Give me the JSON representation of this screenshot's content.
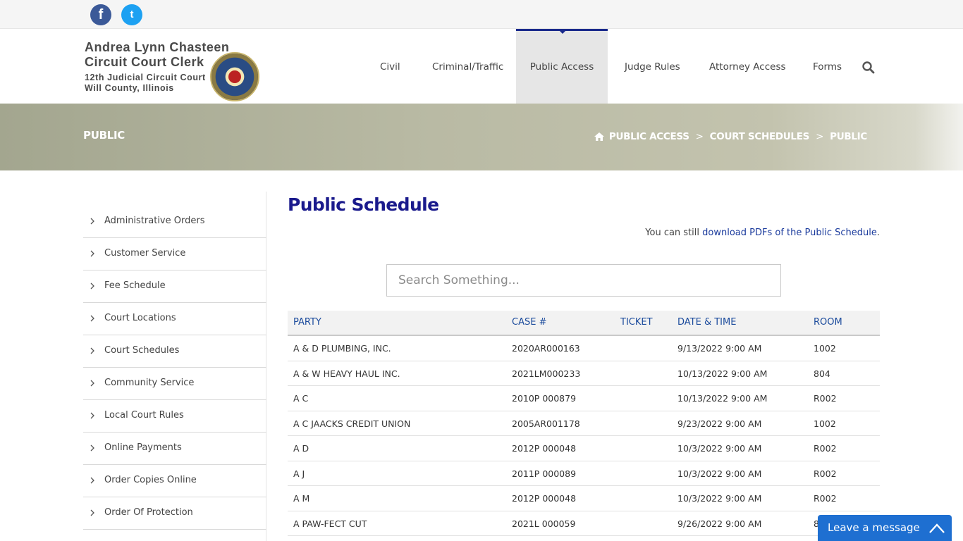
{
  "social": {
    "facebook_glyph": "f",
    "twitter_glyph": "t"
  },
  "logo": {
    "line1": "Andrea Lynn Chasteen",
    "line2": "Circuit Court Clerk",
    "line3": "12th Judicial Circuit Court",
    "line4": "Will County, Illinois"
  },
  "nav": [
    {
      "label": "Civil"
    },
    {
      "label": "Criminal/Traffic"
    },
    {
      "label": "Public Access",
      "active": true
    },
    {
      "label": "Judge Rules"
    },
    {
      "label": "Attorney Access"
    },
    {
      "label": "Forms"
    }
  ],
  "banner": {
    "title": "PUBLIC",
    "crumbs": [
      "PUBLIC ACCESS",
      "COURT SCHEDULES",
      "PUBLIC"
    ],
    "separator": ">"
  },
  "sidebar": {
    "items": [
      {
        "label": "Administrative Orders"
      },
      {
        "label": "Customer Service"
      },
      {
        "label": "Fee Schedule"
      },
      {
        "label": "Court Locations"
      },
      {
        "label": "Court Schedules"
      },
      {
        "label": "Community Service"
      },
      {
        "label": "Local Court Rules"
      },
      {
        "label": "Online Payments"
      },
      {
        "label": "Order Copies Online"
      },
      {
        "label": "Order Of Protection"
      }
    ]
  },
  "main": {
    "title": "Public Schedule",
    "note_prefix": "You can still ",
    "note_link": "download PDFs of the Public Schedule",
    "note_suffix": ".",
    "search_placeholder": "Search Something..."
  },
  "table": {
    "headers": [
      "PARTY",
      "CASE #",
      "TICKET",
      "DATE & TIME",
      "ROOM"
    ],
    "rows": [
      [
        "A & D PLUMBING, INC.",
        "2020AR000163",
        "",
        "9/13/2022 9:00 AM",
        "1002"
      ],
      [
        "A & W HEAVY HAUL INC.",
        "2021LM000233",
        "",
        "10/13/2022 9:00 AM",
        "804"
      ],
      [
        "A C",
        "2010P 000879",
        "",
        "10/13/2022 9:00 AM",
        "R002"
      ],
      [
        "A C JAACKS CREDIT UNION",
        "2005AR001178",
        "",
        "9/23/2022 9:00 AM",
        "1002"
      ],
      [
        "A D",
        "2012P 000048",
        "",
        "10/3/2022 9:00 AM",
        "R002"
      ],
      [
        "A J",
        "2011P 000089",
        "",
        "10/3/2022 9:00 AM",
        "R002"
      ],
      [
        "A M",
        "2012P 000048",
        "",
        "10/3/2022 9:00 AM",
        "R002"
      ],
      [
        "A PAW-FECT CUT",
        "2021L 000059",
        "",
        "9/26/2022 9:00 AM",
        "8"
      ]
    ]
  },
  "chat": {
    "label": "Leave a message"
  },
  "colors": {
    "accent": "#1a2a8c",
    "link": "#1a4a9c",
    "chat": "#1e6fd1",
    "facebook": "#3b5998",
    "twitter": "#1da1f2"
  },
  "icons": [
    "facebook-icon",
    "twitter-icon",
    "search-icon",
    "home-icon",
    "chevron-right-icon",
    "expand-icon"
  ]
}
